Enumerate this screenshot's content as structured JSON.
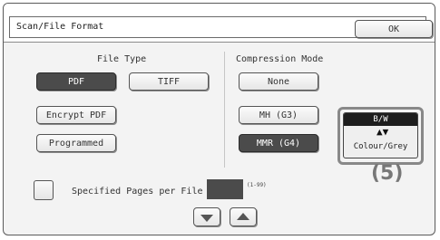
{
  "header": {
    "title": "Scan/File Format",
    "ok_label": "OK"
  },
  "file_type": {
    "label": "File Type",
    "buttons": {
      "pdf": "PDF",
      "tiff": "TIFF",
      "encrypt_pdf": "Encrypt PDF",
      "programmed": "Programmed"
    },
    "selected": "PDF"
  },
  "compression": {
    "label": "Compression Mode",
    "buttons": {
      "none": "None",
      "mh": "MH (G3)",
      "mmr": "MMR (G4)"
    },
    "selected": "MMR (G4)"
  },
  "colour_toggle": {
    "top_label": "B/W",
    "arrow": "▲▼",
    "bottom_label": "Colour/Grey"
  },
  "callout": {
    "number": "(5)"
  },
  "pages": {
    "label": "Specified Pages per File",
    "range": "(1-99)",
    "value": ""
  },
  "icons": {
    "down": "arrow-down-icon",
    "up": "arrow-up-icon"
  }
}
